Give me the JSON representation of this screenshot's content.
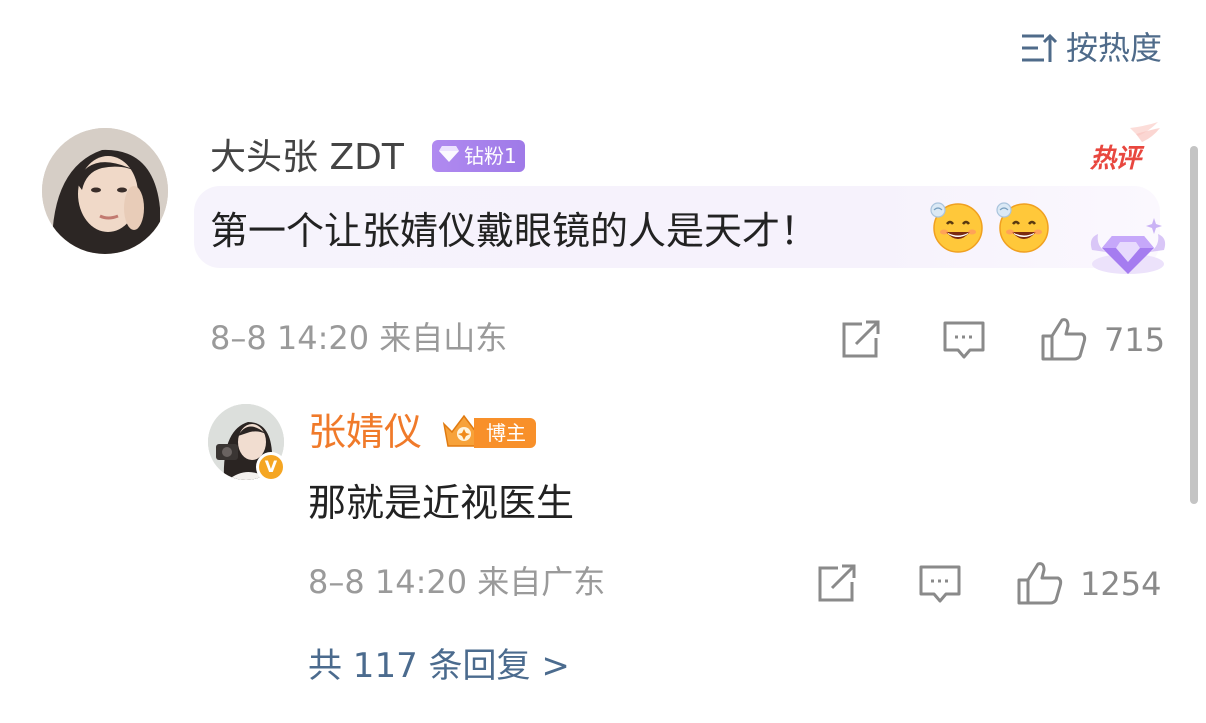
{
  "sort": {
    "label": "按热度",
    "icon": "sort-icon"
  },
  "comment": {
    "username": "大头张 ZDT",
    "fan_badge": "钻粉1",
    "hot_badge": "热评",
    "text": "第一个让张婧仪戴眼镜的人是天才！",
    "emojis": [
      "grin-emoji",
      "grin-emoji"
    ],
    "meta": "8–8 14:20  来自山东",
    "like_count": "715"
  },
  "reply": {
    "username": "张婧仪",
    "badge_label": "博主",
    "text": "那就是近视医生",
    "meta": "8–8 14:20  来自广东",
    "like_count": "1254"
  },
  "more_replies": "共 117 条回复 >",
  "colors": {
    "link": "#4f6b8a",
    "author_orange": "#f07a2a",
    "fan_purple": "#a580ee",
    "hot_red": "#e8473f",
    "meta_gray": "#9a9a9a"
  }
}
